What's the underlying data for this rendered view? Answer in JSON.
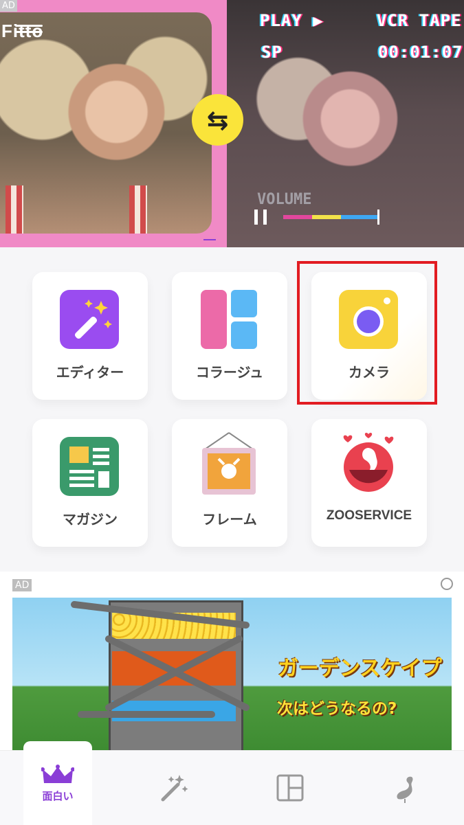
{
  "banner": {
    "ad_label": "AD",
    "logo": "Fitto",
    "vcr_play": "PLAY ▶",
    "vcr_tape": "VCR TAPE",
    "vcr_mode": "SP",
    "vcr_time": "00:01:07",
    "vcr_volume": "VOLUME",
    "swap_glyph": "⇆"
  },
  "tiles": [
    {
      "label": "エディター",
      "icon": "magic-wand-icon",
      "color": "#9a4cf0"
    },
    {
      "label": "コラージュ",
      "icon": "collage-layout-icon",
      "color": "#ec6aa8"
    },
    {
      "label": "カメラ",
      "icon": "camera-icon",
      "color": "#f8d33a"
    },
    {
      "label": "マガジン",
      "icon": "magazine-icon",
      "color": "#3a9a6b"
    },
    {
      "label": "フレーム",
      "icon": "frame-icon",
      "color": "#f1b84e"
    },
    {
      "label": "ZOOSERVICE",
      "icon": "flamingo-icon",
      "color": "#e9414f"
    }
  ],
  "ad_banner": {
    "ad_label": "AD",
    "title": "ガーデンスケイプ",
    "subtitle": "次はどうなるの?"
  },
  "tabbar": {
    "tabs": [
      {
        "label": "面白い",
        "icon": "crown-icon",
        "active": true
      },
      {
        "label": "",
        "icon": "magic-wand-icon"
      },
      {
        "label": "",
        "icon": "collage-layout-icon"
      },
      {
        "label": "",
        "icon": "flamingo-icon"
      }
    ],
    "accent": "#8a3ed6"
  }
}
